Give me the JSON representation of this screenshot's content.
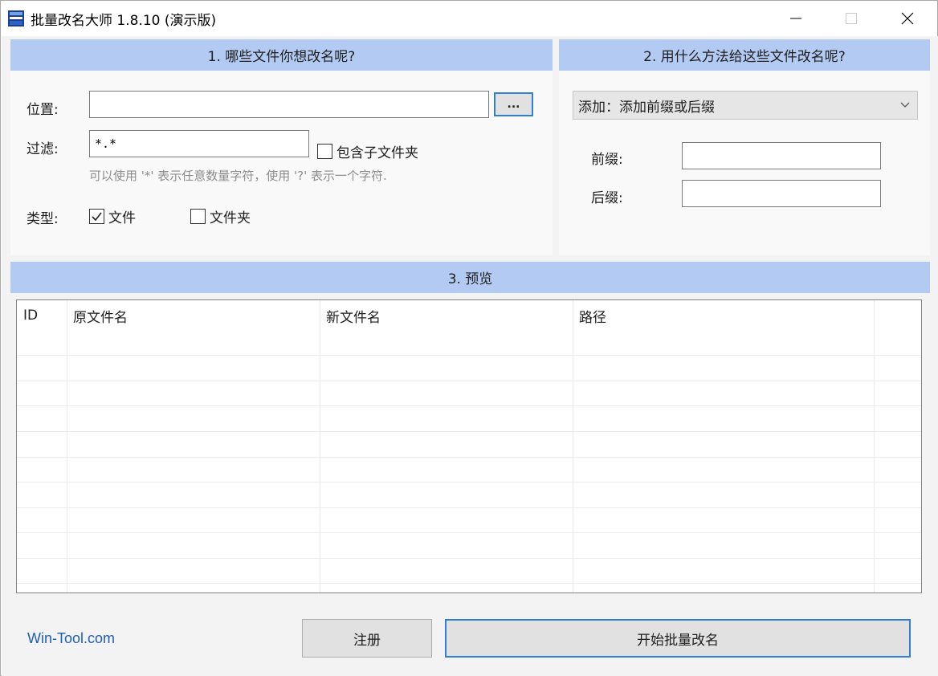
{
  "window": {
    "title": "批量改名大师 1.8.10 (演示版)"
  },
  "section1": {
    "header": "1. 哪些文件你想改名呢?",
    "location_label": "位置:",
    "location_value": "",
    "browse_label": "...",
    "filter_label": "过滤:",
    "filter_value": "*.*",
    "include_subfolders_label": "包含子文件夹",
    "include_subfolders_checked": false,
    "hint": "可以使用 '*' 表示任意数量字符，使用 '?' 表示一个字符.",
    "type_label": "类型:",
    "type_file_label": "文件",
    "type_file_checked": true,
    "type_folder_label": "文件夹",
    "type_folder_checked": false
  },
  "section2": {
    "header": "2. 用什么方法给这些文件改名呢?",
    "method_selected": "添加：添加前缀或后缀",
    "prefix_label": "前缀:",
    "prefix_value": "",
    "suffix_label": "后缀:",
    "suffix_value": ""
  },
  "section3": {
    "header": "3. 预览",
    "columns": [
      "ID",
      "原文件名",
      "新文件名",
      "路径"
    ],
    "rows": []
  },
  "footer": {
    "link_text": "Win-Tool.com",
    "register_label": "注册",
    "start_label": "开始批量改名"
  },
  "colors": {
    "section_header_bg": "#b3cbf3",
    "accent_border": "#2f7fd6",
    "link": "#1f5eb9"
  }
}
